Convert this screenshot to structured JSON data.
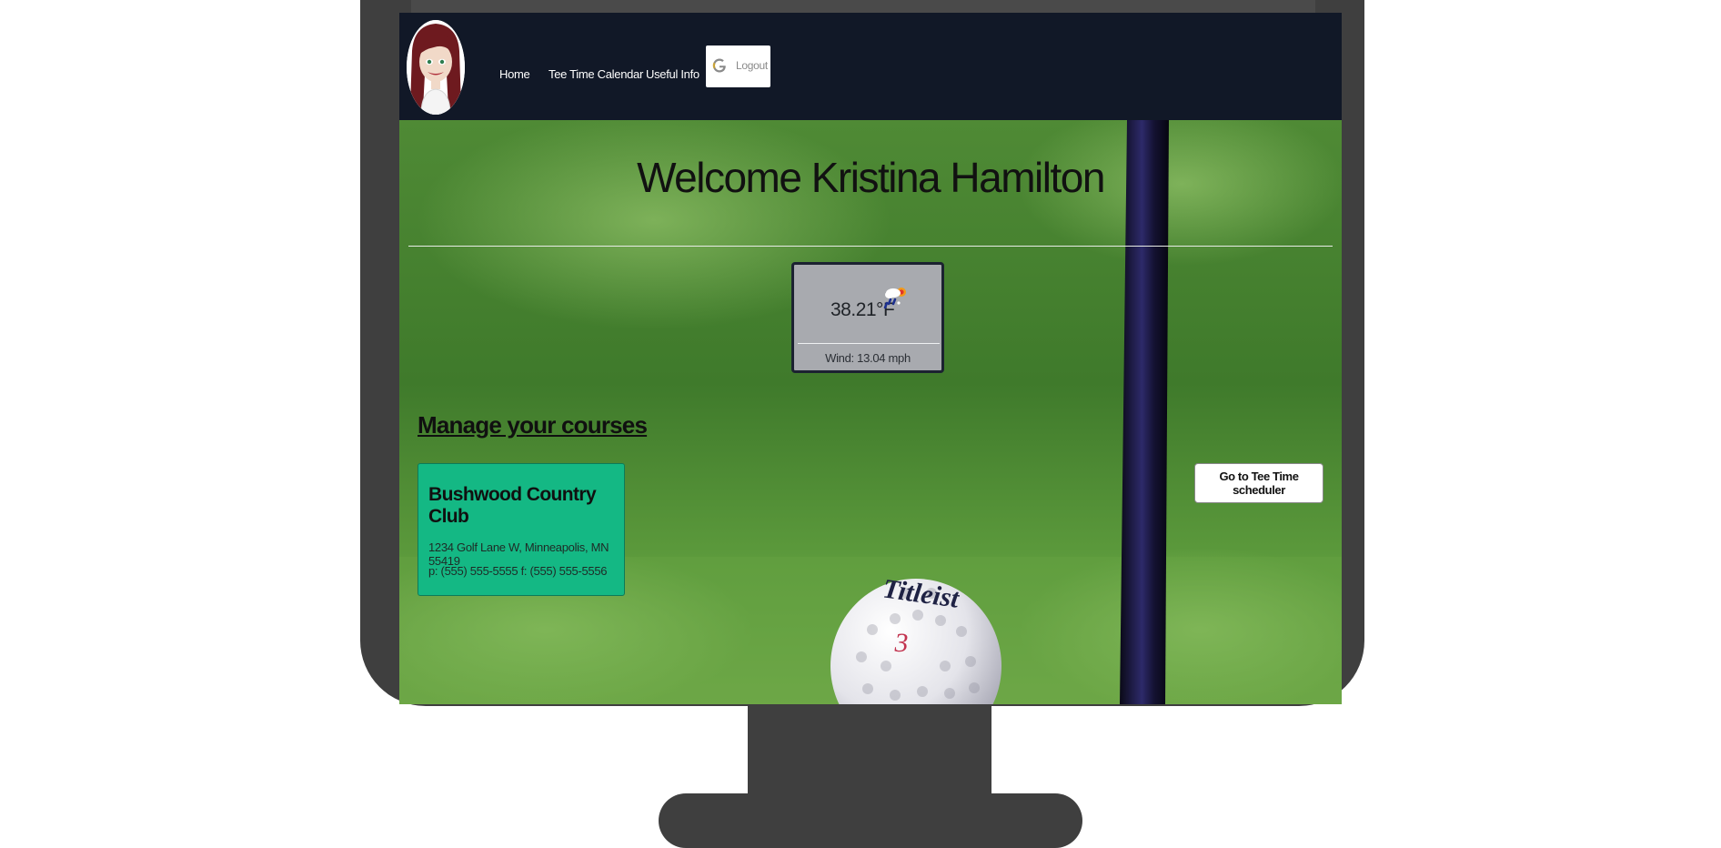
{
  "nav": {
    "links": [
      "Home",
      "Tee Time Calendar",
      "Useful Info"
    ],
    "logout_label": "Logout"
  },
  "hero": {
    "welcome": "Welcome Kristina Hamilton"
  },
  "weather": {
    "temperature": "38.21°F",
    "wind": "Wind: 13.04 mph",
    "icon": "rain-snow-sun-icon"
  },
  "courses": {
    "title": "Manage your courses",
    "items": [
      {
        "name": "Bushwood Country Club",
        "address": "1234 Golf Lane W, Minneapolis, MN 55419",
        "phone": "p: (555) 555-5555 f: (555) 555-5556"
      }
    ]
  },
  "scheduler": {
    "button_label": "Go to Tee Time scheduler"
  },
  "golf_ball": {
    "brand": "Titleist",
    "number": "3"
  },
  "colors": {
    "navbar": "#111827",
    "course_card": "#14b884",
    "weather_card": "#a8aaaf",
    "grass": "#4b7d34"
  }
}
